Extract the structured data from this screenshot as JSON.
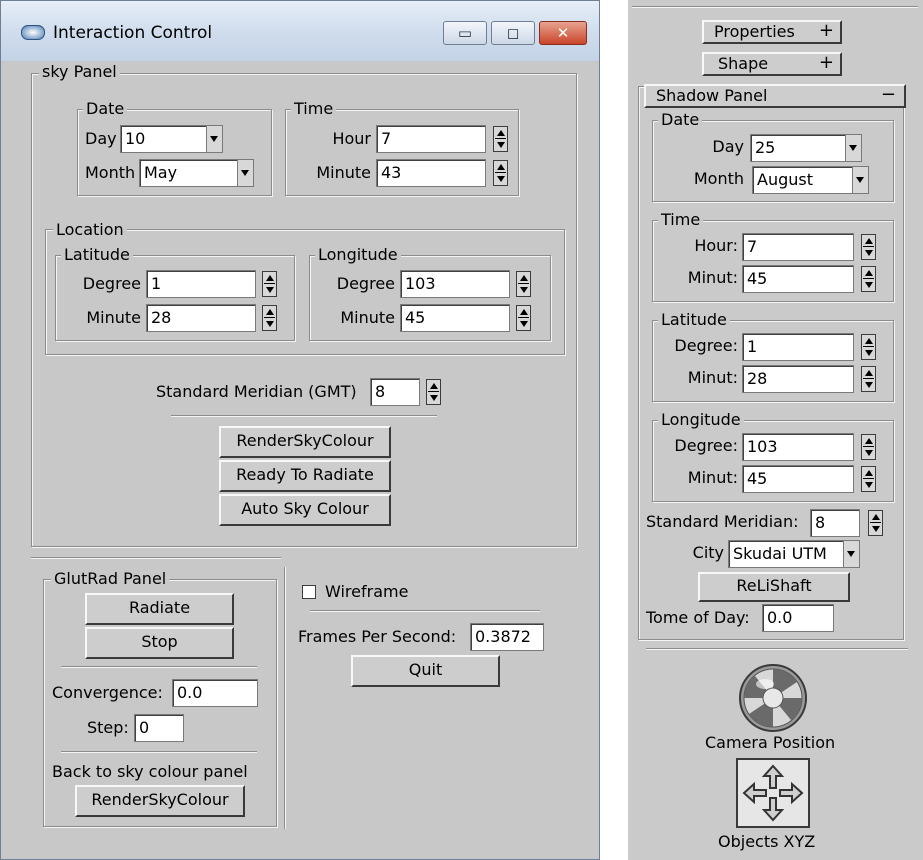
{
  "window": {
    "title": "Interaction Control",
    "buttons": {
      "minimize": "▭",
      "maximize": "◻",
      "close": "✕"
    }
  },
  "sky_panel": {
    "title": "sky Panel",
    "date": {
      "title": "Date",
      "day_label": "Day",
      "day_value": "10",
      "month_label": "Month",
      "month_value": "May"
    },
    "time": {
      "title": "Time",
      "hour_label": "Hour",
      "hour_value": "7",
      "minute_label": "Minute",
      "minute_value": "43"
    },
    "location": {
      "title": "Location",
      "latitude": {
        "title": "Latitude",
        "degree_label": "Degree",
        "degree_value": "1",
        "minute_label": "Minute",
        "minute_value": "28"
      },
      "longitude": {
        "title": "Longitude",
        "degree_label": "Degree",
        "degree_value": "103",
        "minute_label": "Minute",
        "minute_value": "45"
      }
    },
    "meridian_label": "Standard Meridian (GMT)",
    "meridian_value": "8",
    "buttons": {
      "render": "RenderSkyColour",
      "ready": "Ready To Radiate",
      "auto": "Auto Sky Colour"
    }
  },
  "glutrad_panel": {
    "title": "GlutRad Panel",
    "radiate": "Radiate",
    "stop": "Stop",
    "convergence_label": "Convergence:",
    "convergence_value": "0.0",
    "step_label": "Step:",
    "step_value": "0",
    "back_label": "Back to sky colour panel",
    "render": "RenderSkyColour"
  },
  "misc": {
    "wireframe_label": "Wireframe",
    "wireframe_checked": false,
    "fps_label": "Frames Per Second:",
    "fps_value": "0.3872",
    "quit": "Quit"
  },
  "right_panel": {
    "properties": "Properties",
    "shape": "Shape",
    "plus": "+",
    "minus": "−",
    "shadow_panel": {
      "title": "Shadow Panel",
      "date": {
        "title": "Date",
        "day_label": "Day",
        "day_value": "25",
        "month_label": "Month",
        "month_value": "August"
      },
      "time": {
        "title": "Time",
        "hour_label": "Hour:",
        "hour_value": "7",
        "minute_label": "Minut:",
        "minute_value": "45"
      },
      "latitude": {
        "title": "Latitude",
        "degree_label": "Degree:",
        "degree_value": "1",
        "minute_label": "Minut:",
        "minute_value": "28"
      },
      "longitude": {
        "title": "Longitude",
        "degree_label": "Degree:",
        "degree_value": "103",
        "minute_label": "Minut:",
        "minute_value": "45"
      },
      "meridian_label": "Standard Meridian:",
      "meridian_value": "8",
      "city_label": "City",
      "city_value": "Skudai UTM",
      "relishaft": "ReLiShaft",
      "tod_label": "Tome of Day:",
      "tod_value": "0.0"
    },
    "camera_label": "Camera Position",
    "objects_label": "Objects XYZ"
  }
}
